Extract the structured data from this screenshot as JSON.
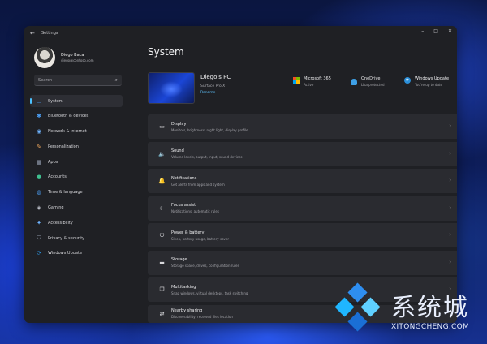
{
  "window": {
    "title": "Settings",
    "back": "←",
    "minimize": "–",
    "maximize": "□",
    "close": "✕"
  },
  "profile": {
    "name": "Diego Baca",
    "email": "diego@contoso.com"
  },
  "search": {
    "placeholder": "Search",
    "icon": "⌕"
  },
  "nav": [
    {
      "label": "System",
      "icon": "monitor-icon",
      "color": "#4c9ff5",
      "active": true
    },
    {
      "label": "Bluetooth & devices",
      "icon": "bluetooth-icon",
      "color": "#4c9ff5"
    },
    {
      "label": "Network & internet",
      "icon": "wifi-icon",
      "color": "#6fb4ff"
    },
    {
      "label": "Personalization",
      "icon": "brush-icon",
      "color": "#e6a15a"
    },
    {
      "label": "Apps",
      "icon": "apps-icon",
      "color": "#9aa4b8"
    },
    {
      "label": "Accounts",
      "icon": "person-icon",
      "color": "#3fbf8f"
    },
    {
      "label": "Time & language",
      "icon": "globe-icon",
      "color": "#4c9ff5"
    },
    {
      "label": "Gaming",
      "icon": "gamepad-icon",
      "color": "#b9bcc6"
    },
    {
      "label": "Accessibility",
      "icon": "accessibility-icon",
      "color": "#6fb4ff"
    },
    {
      "label": "Privacy & security",
      "icon": "shield-icon",
      "color": "#8f98a8"
    },
    {
      "label": "Windows Update",
      "icon": "update-icon",
      "color": "#2b8fd9"
    }
  ],
  "main": {
    "title": "System",
    "device": {
      "name": "Diego's PC",
      "model": "Surface Pro X",
      "rename": "Rename"
    },
    "quick": [
      {
        "title": "Microsoft 365",
        "sub": "Active",
        "icon": "microsoft-icon"
      },
      {
        "title": "OneDrive",
        "sub": "Lisa protected",
        "icon": "cloud-icon"
      },
      {
        "title": "Windows Update",
        "sub": "You're up to date",
        "icon": "update-icon"
      }
    ],
    "items": [
      {
        "title": "Display",
        "sub": "Monitors, brightness, night light, display profile",
        "icon": "▭"
      },
      {
        "title": "Sound",
        "sub": "Volume levels, output, input, sound devices",
        "icon": "🔈"
      },
      {
        "title": "Notifications",
        "sub": "Get alerts from apps and system",
        "icon": "🔔"
      },
      {
        "title": "Focus assist",
        "sub": "Notifications, automatic rules",
        "icon": "☾"
      },
      {
        "title": "Power & battery",
        "sub": "Sleep, battery usage, battery saver",
        "icon": "⏻"
      },
      {
        "title": "Storage",
        "sub": "Storage space, drives, configuration rules",
        "icon": "▬"
      },
      {
        "title": "Multitasking",
        "sub": "Snap windows, virtual desktops, task switching",
        "icon": "❐"
      },
      {
        "title": "Nearby sharing",
        "sub": "Discoverability, received files location",
        "icon": "⇄"
      }
    ],
    "chevron": "›"
  },
  "watermark": {
    "cn": "系统城",
    "en": "XITONGCHENG.COM",
    "colors": [
      "#2e8ef0",
      "#1fb6ff",
      "#5fd0ff",
      "#1a6fd6"
    ]
  }
}
